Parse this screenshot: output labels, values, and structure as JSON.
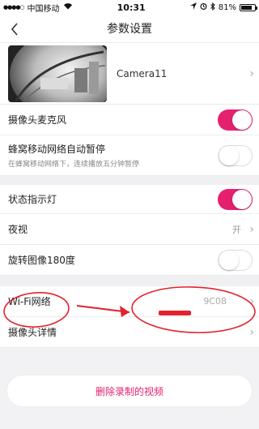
{
  "status_bar": {
    "carrier": "中国移动",
    "time": "10:31",
    "battery": "81%",
    "battery_level": 0.81
  },
  "nav": {
    "title": "参数设置",
    "back_icon": "chevron-left-icon"
  },
  "camera": {
    "name": "Camera11"
  },
  "settings": {
    "mic_label": "摄像头麦克风",
    "mic_on": true,
    "cellular_label": "蜂窝移动网络自动暂停",
    "cellular_sub": "在蜂窝移动网络下，连续播放五分钟暂停",
    "cellular_on": false,
    "status_light_label": "状态指示灯",
    "status_light_on": true,
    "night_label": "夜视",
    "night_value": "开",
    "rotate_label": "旋转图像180度",
    "rotate_on": false,
    "wifi_label": "Wi-Fi网络",
    "wifi_value": "9C08",
    "details_label": "摄像头详情"
  },
  "actions": {
    "delete_label": "删除录制的视频"
  },
  "colors": {
    "accent": "#e5206f",
    "annotation": "#e3222f"
  }
}
